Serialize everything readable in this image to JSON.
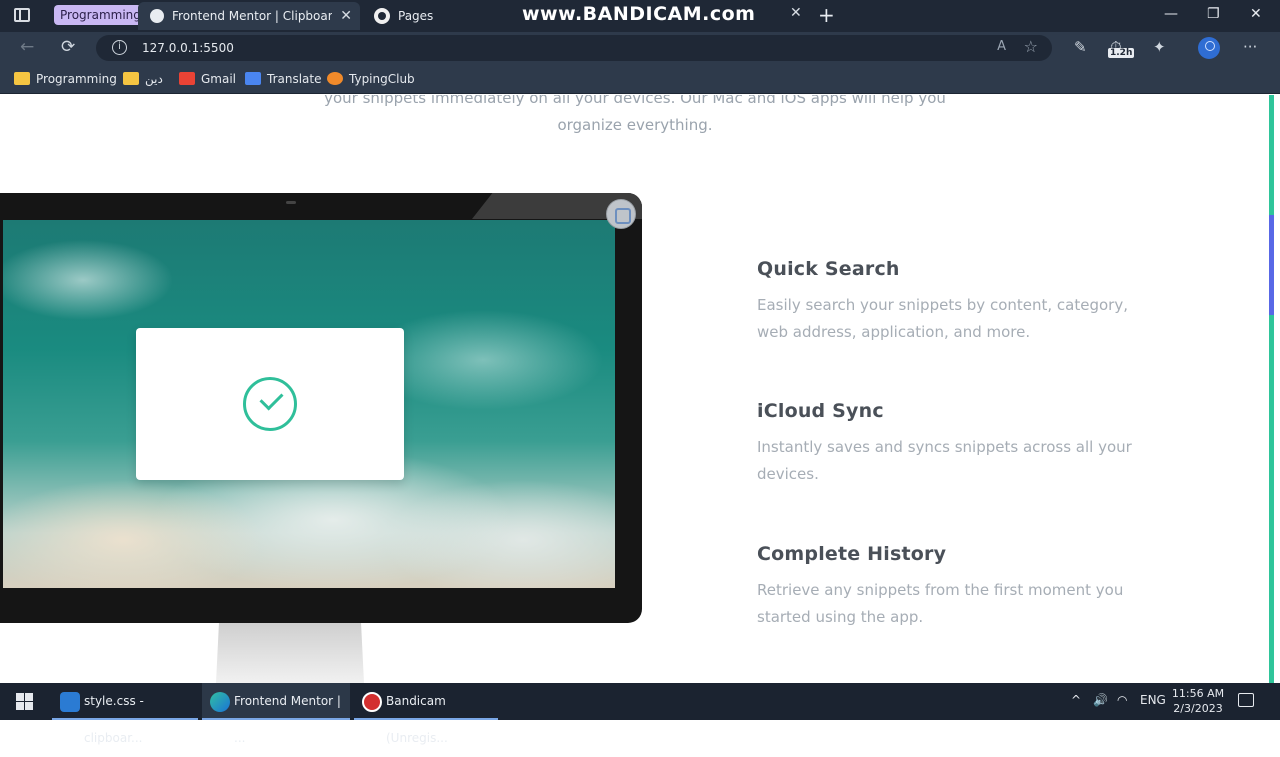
{
  "browser": {
    "tab_group_label": "Programming",
    "active_tab_title": "Frontend Mentor | Clipboard landing page",
    "second_tab_title": "Pages",
    "watermark": "www.BANDICAM.com",
    "address_url": "127.0.0.1:5500",
    "extension_badge": "1.2h",
    "bookmarks": [
      "Programming",
      "دین",
      "Gmail",
      "Translate",
      "TypingClub"
    ]
  },
  "page": {
    "intro_line1": "your snippets immediately on all your devices. Our Mac and iOS apps will help you",
    "intro_line2": "organize everything.",
    "features": [
      {
        "title": "Quick Search",
        "text": "Easily search your snippets by content, category, web address, application, and more."
      },
      {
        "title": "iCloud Sync",
        "text": "Instantly saves and syncs snippets across all your devices."
      },
      {
        "title": "Complete History",
        "text": "Retrieve any snippets from the first moment you started using the app."
      }
    ]
  },
  "taskbar": {
    "items": [
      "style.css - clipboar...",
      "Frontend Mentor | ...",
      "Bandicam (Unregis..."
    ],
    "language": "ENG",
    "time": "11:56 AM",
    "date": "2/3/2023"
  },
  "icons": {
    "check": "check-circle-icon",
    "apple": "apple-logo-icon"
  },
  "colors": {
    "accent": "#2fbf9a",
    "heading": "#4a5058",
    "body_text": "#a6adb5",
    "browser_dark": "#1f2836",
    "tab_group": "#c9b8f3"
  }
}
